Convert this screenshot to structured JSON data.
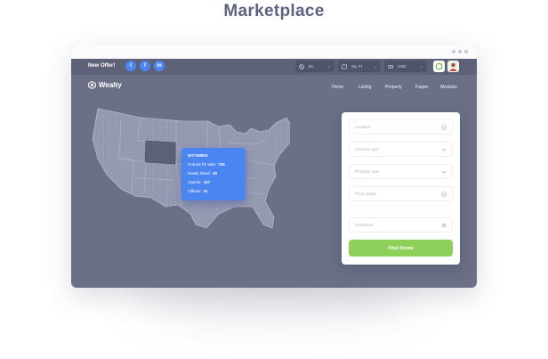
{
  "page": {
    "title": "Marketplace"
  },
  "topbar": {
    "offer_label": "New Offer!",
    "social": [
      {
        "icon": "twitter-icon",
        "glyph": "t"
      },
      {
        "icon": "facebook-icon",
        "glyph": "f"
      },
      {
        "icon": "linkedin-icon",
        "glyph": "in"
      }
    ],
    "language": {
      "icon": "globe-icon",
      "value": "En"
    },
    "unit": {
      "icon": "map-icon",
      "value": "Sq. Ft."
    },
    "currency": {
      "icon": "money-icon",
      "value": "USD"
    }
  },
  "nav": {
    "brand": "Wealty",
    "links": [
      "Home",
      "Listing",
      "Property",
      "Pages",
      "Modules"
    ]
  },
  "tooltip": {
    "title": "WYOMING",
    "rows": [
      {
        "label": "Homes for sale:",
        "value": "706"
      },
      {
        "label": "Newly listed:",
        "value": "28"
      },
      {
        "label": "Agents:",
        "value": "157"
      },
      {
        "label": "Offices:",
        "value": "31"
      }
    ]
  },
  "search": {
    "location_placeholder": "Location",
    "contract_placeholder": "Contract type",
    "property_placeholder": "Property type",
    "price_placeholder": "Price range",
    "advanced_placeholder": "Advanced",
    "submit_label": "Find Home"
  },
  "colors": {
    "accent_blue": "#4b85f2",
    "button_green": "#8dd15a",
    "hero_bg": "#6b7087",
    "highlight_state": "#5c6276"
  }
}
